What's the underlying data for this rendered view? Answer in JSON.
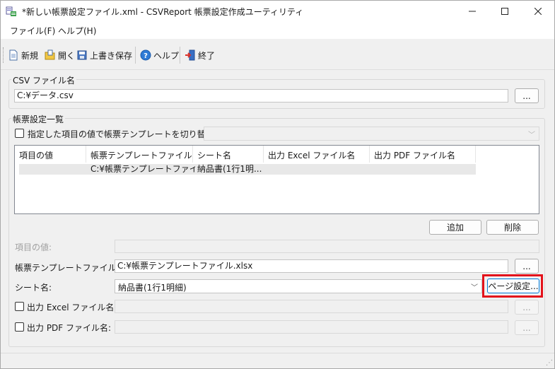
{
  "window": {
    "title": "*新しい帳票設定ファイル.xml - CSVReport 帳票設定作成ユーティリティ"
  },
  "menu": {
    "file": "ファイル(F)",
    "help": "ヘルプ(H)"
  },
  "toolbar": {
    "new_label": "新規",
    "open_label": "開く",
    "save_label": "上書き保存",
    "help_label": "ヘルプ",
    "exit_label": "終了"
  },
  "csv_group": {
    "label": "CSV ファイル名",
    "value": "C:¥データ.csv",
    "browse_label": "..."
  },
  "report_group": {
    "label": "帳票設定一覧",
    "switch_checkbox_label": "指定した項目の値で帳票テンプレートを切り替える:",
    "switch_combo_value": "",
    "columns": [
      "項目の値",
      "帳票テンプレートファイル名",
      "シート名",
      "出力 Excel ファイル名",
      "出力 PDF ファイル名"
    ],
    "rows": [
      [
        "",
        "C:¥帳票テンプレートファイル...",
        "納品書(1行1明...",
        "",
        ""
      ]
    ],
    "add_label": "追加",
    "delete_label": "削除",
    "item_value_label": "項目の値:",
    "item_value": "",
    "template_label": "帳票テンプレートファイル名:",
    "template_value": "C:¥帳票テンプレートファイル.xlsx",
    "template_browse": "...",
    "sheet_label": "シート名:",
    "sheet_value": "納品書(1行1明細)",
    "page_setup_label": "ページ設定...",
    "excel_label": "出力 Excel ファイル名:",
    "excel_value": "",
    "excel_browse": "...",
    "pdf_label": "出力 PDF ファイル名:",
    "pdf_value": "",
    "pdf_browse": "..."
  },
  "colors": {
    "highlight": "#e3121b",
    "window_bg": "#f0f0f0"
  }
}
